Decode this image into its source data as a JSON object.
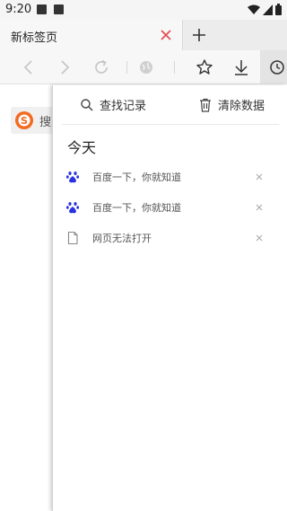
{
  "status_bar": {
    "time": "9:20"
  },
  "tab": {
    "title": "新标签页"
  },
  "page": {
    "search_chip_text": "搜"
  },
  "history_panel": {
    "find_label": "查找记录",
    "clear_label": "清除数据",
    "section_title": "今天",
    "items": [
      {
        "title": "百度一下，你就知道",
        "icon": "baidu-paw-icon"
      },
      {
        "title": "百度一下，你就知道",
        "icon": "baidu-paw-icon"
      },
      {
        "title": "网页无法打开",
        "icon": "document-icon"
      }
    ]
  },
  "colors": {
    "tab_close": "#e5484d",
    "baidu_blue": "#2932e1",
    "sogou_orange": "#f26b21"
  }
}
